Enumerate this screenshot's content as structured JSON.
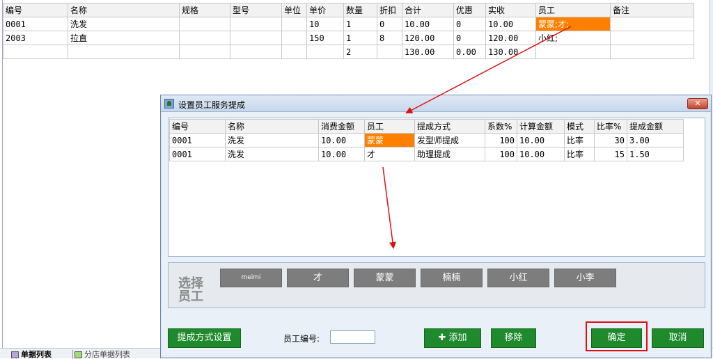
{
  "main_table": {
    "headers": [
      "编号",
      "名称",
      "规格",
      "型号",
      "单位",
      "单价",
      "数量",
      "折扣",
      "合计",
      "优惠",
      "实收",
      "员工",
      "备注"
    ],
    "rows": [
      [
        "0001",
        "洗发",
        "",
        "",
        "",
        "10",
        "1",
        "0",
        "10.00",
        "0",
        "10.00",
        "蒙蒙;才;",
        ""
      ],
      [
        "2003",
        "拉直",
        "",
        "",
        "",
        "150",
        "1",
        "8",
        "120.00",
        "0",
        "120.00",
        "小红;",
        ""
      ]
    ],
    "totals": [
      "",
      "",
      "",
      "",
      "",
      "",
      "2",
      "",
      "130.00",
      "0.00",
      "130.00",
      "",
      ""
    ]
  },
  "status_bar": {
    "tab1": "单据列表",
    "tab2": "分店单据列表"
  },
  "dialog": {
    "title": "设置员工服务提成",
    "close_glyph": "✕",
    "table": {
      "headers": [
        "编号",
        "名称",
        "消费金额",
        "员工",
        "提成方式",
        "系数%",
        "计算金额",
        "模式",
        "比率%",
        "提成金额"
      ],
      "rows": [
        [
          "0001",
          "洗发",
          "10.00",
          "蒙蒙",
          "发型师提成",
          "100",
          "10.00",
          "比率",
          "30",
          "3.00"
        ],
        [
          "0001",
          "洗发",
          "10.00",
          "才",
          "助理提成",
          "100",
          "10.00",
          "比率",
          "15",
          "1.50"
        ]
      ]
    },
    "select_label": "选择员工",
    "staff": [
      "meimi",
      "才",
      "蒙蒙",
      "楠楠",
      "小红",
      "小李"
    ],
    "buttons": {
      "commission_settings": "提成方式设置",
      "staff_no_label": "员工编号:",
      "staff_no_value": "",
      "add": "添加",
      "add_glyph": "✚",
      "remove": "移除",
      "confirm": "确定",
      "cancel": "取消"
    }
  },
  "colors": {
    "highlight": "#ff8000",
    "button_green": "#1e8a2c",
    "staff_button": "#7d7d7d",
    "annotation_red": "#e01010"
  }
}
